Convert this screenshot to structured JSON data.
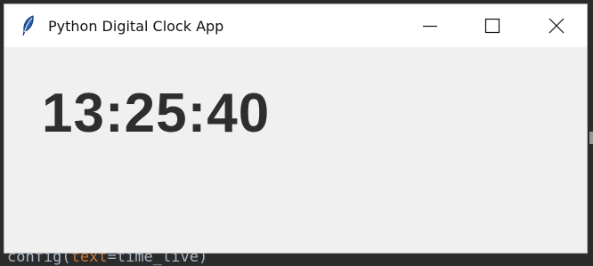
{
  "window": {
    "title": "Python Digital Clock App",
    "controls": {
      "minimize_icon": "minimize-icon",
      "maximize_icon": "maximize-icon",
      "close_icon": "close-icon"
    }
  },
  "clock": {
    "time": "13:25:40"
  },
  "background_editor": {
    "code_fragment_method": "config(",
    "code_fragment_param": "text",
    "code_fragment_value": "=time_live)"
  },
  "colors": {
    "window_bg": "#f0f0f0",
    "titlebar_bg": "#ffffff",
    "clock_text": "#2e2e2e",
    "editor_bg": "#2b2b2b"
  }
}
